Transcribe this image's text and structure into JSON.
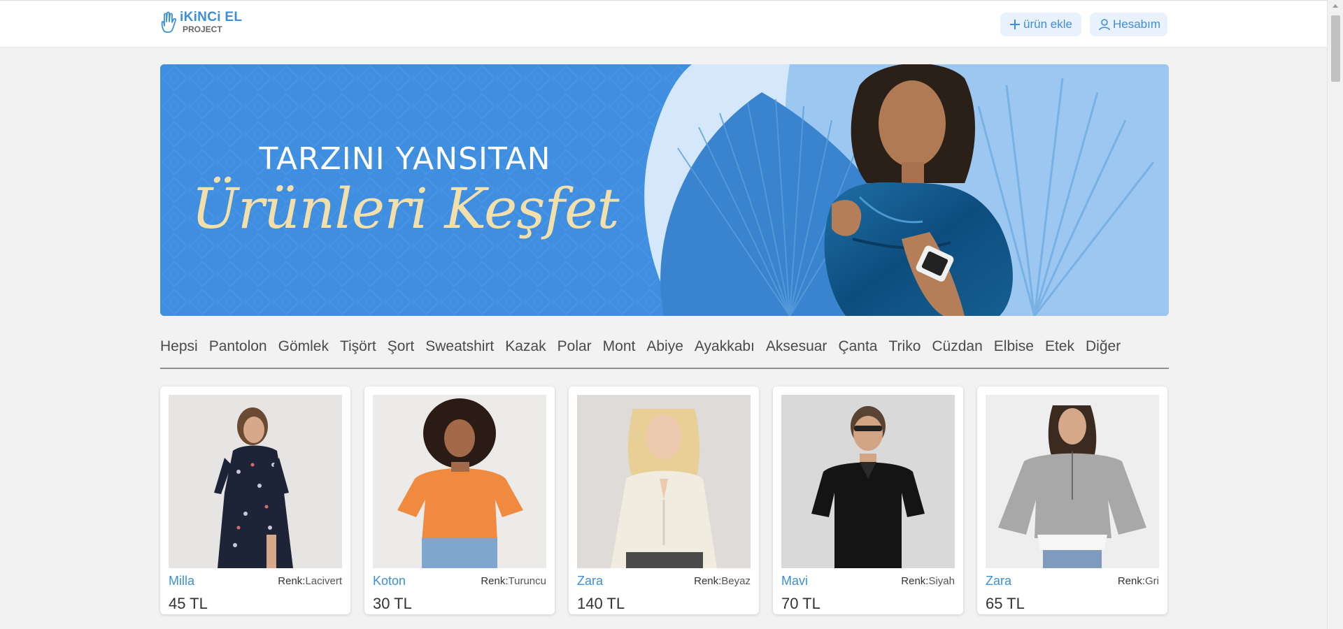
{
  "header": {
    "logo_main": "iKiNCi EL",
    "logo_sub": "PROJECT",
    "add_product_label": "ürün ekle",
    "account_label": "Hesabım"
  },
  "banner": {
    "line1": "TARZINI YANSITAN",
    "line2": "Ürünleri Keşfet"
  },
  "categories": [
    "Hepsi",
    "Pantolon",
    "Gömlek",
    "Tişört",
    "Şort",
    "Sweatshirt",
    "Kazak",
    "Polar",
    "Mont",
    "Abiye",
    "Ayakkabı",
    "Aksesuar",
    "Çanta",
    "Triko",
    "Cüzdan",
    "Elbise",
    "Etek",
    "Diğer"
  ],
  "products": [
    {
      "brand": "Milla",
      "color_label": "Renk:",
      "color": "Lacivert",
      "price": "45 TL"
    },
    {
      "brand": "Koton",
      "color_label": "Renk:",
      "color": "Turuncu",
      "price": "30 TL"
    },
    {
      "brand": "Zara",
      "color_label": "Renk:",
      "color": "Beyaz",
      "price": "140 TL"
    },
    {
      "brand": "Mavi",
      "color_label": "Renk:",
      "color": "Siyah",
      "price": "70 TL"
    },
    {
      "brand": "Zara",
      "color_label": "Renk:",
      "color": "Gri",
      "price": "65 TL"
    }
  ],
  "colors": {
    "accent": "#3b8fd9",
    "background": "#f2f2f2",
    "banner_blue": "#3f8ee0",
    "banner_script": "#f3dfa9"
  },
  "icons": [
    "hand-logo-icon",
    "plus-icon",
    "user-icon"
  ]
}
